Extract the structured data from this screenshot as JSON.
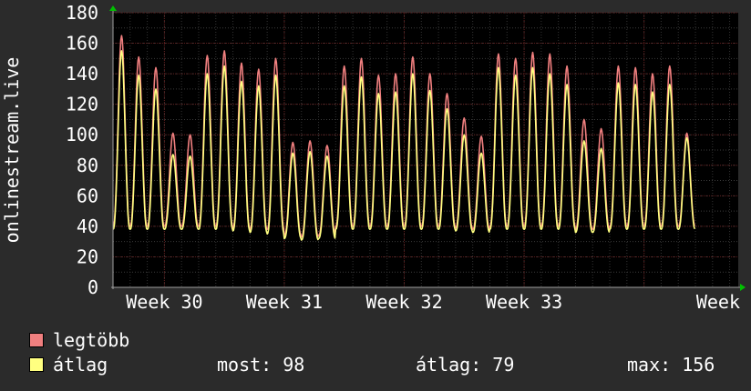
{
  "colors": {
    "background": "#2b2b2b",
    "plot_background": "#000000",
    "grid_major": "#5a1a1a",
    "axis": "#a0a0a0",
    "max_series": "#f07f7f",
    "avg_series": "#ffff80",
    "arrow": "#00c000"
  },
  "chart_data": {
    "type": "line",
    "ylabel": "onlinestream.live",
    "ylim": [
      0,
      180
    ],
    "y_ticks": [
      0,
      20,
      40,
      60,
      80,
      100,
      120,
      140,
      160,
      180
    ],
    "x_range_days": [
      0,
      36.5
    ],
    "x_ticks": [
      {
        "label": "Week 30",
        "x_day": 3
      },
      {
        "label": "Week 31",
        "x_day": 10
      },
      {
        "label": "Week 32",
        "x_day": 17
      },
      {
        "label": "Week 33",
        "x_day": 24
      },
      {
        "label": "Week",
        "x_day": 31
      }
    ],
    "grid": true,
    "series": [
      {
        "name": "legtöbb",
        "color": "#f07f7f",
        "daily_peak": [
          165,
          151,
          144,
          101,
          100,
          152,
          155,
          147,
          143,
          150,
          95,
          96,
          93,
          145,
          150,
          139,
          140,
          151,
          140,
          127,
          111,
          99,
          153,
          150,
          154,
          153,
          145,
          110,
          104,
          145,
          144,
          140,
          145,
          101
        ],
        "daily_trough": [
          40,
          40,
          40,
          40,
          40,
          40,
          40,
          39,
          38,
          38,
          34,
          33,
          34,
          40,
          40,
          40,
          40,
          40,
          40,
          40,
          39,
          38,
          40,
          40,
          40,
          40,
          40,
          38,
          38,
          40,
          40,
          40,
          40,
          40
        ]
      },
      {
        "name": "átlag",
        "color": "#ffff80",
        "daily_peak": [
          155,
          139,
          130,
          87,
          86,
          140,
          145,
          135,
          132,
          139,
          88,
          89,
          86,
          132,
          138,
          127,
          128,
          140,
          129,
          117,
          100,
          88,
          144,
          139,
          144,
          140,
          133,
          96,
          91,
          134,
          133,
          128,
          133,
          98
        ],
        "daily_trough": [
          38,
          38,
          38,
          38,
          38,
          38,
          38,
          37,
          36,
          35,
          32,
          31,
          32,
          38,
          38,
          38,
          38,
          38,
          38,
          38,
          37,
          36,
          38,
          38,
          38,
          38,
          38,
          36,
          36,
          38,
          38,
          38,
          38,
          38
        ]
      }
    ]
  },
  "legend": {
    "items": [
      {
        "label": "legtöbb",
        "color": "#f07f7f"
      },
      {
        "label": "átlag",
        "color": "#ffff80"
      }
    ]
  },
  "stats": {
    "now": "most: 98",
    "average": "átlag: 79",
    "max": "max: 156"
  }
}
